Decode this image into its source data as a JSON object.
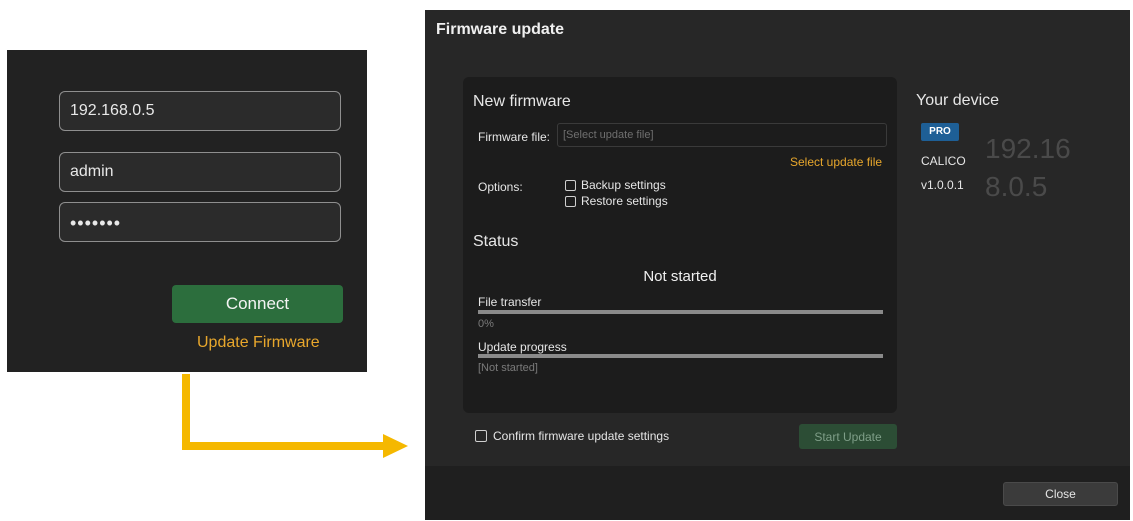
{
  "login": {
    "ip_value": "192.168.0.5",
    "username_value": "admin",
    "password_mask": "•••••••",
    "connect_label": "Connect",
    "update_firmware_label": "Update Firmware"
  },
  "dialog": {
    "title": "Firmware update",
    "new_firmware": {
      "title": "New firmware",
      "file_label": "Firmware file:",
      "file_placeholder": "[Select update file]",
      "select_link": "Select update file",
      "options_label": "Options:",
      "backup_label": "Backup settings",
      "restore_label": "Restore settings"
    },
    "status": {
      "title": "Status",
      "state": "Not started",
      "file_transfer_label": "File transfer",
      "file_transfer_value": "0%",
      "file_transfer_progress": 0,
      "update_progress_label": "Update progress",
      "update_progress_value": "[Not started]",
      "update_progress": 0
    },
    "device": {
      "title": "Your device",
      "badge": "PRO",
      "name": "CALICO",
      "version": "v1.0.0.1",
      "ip": "192.168.0.5"
    },
    "confirm_label": "Confirm firmware update settings",
    "start_label": "Start Update",
    "close_label": "Close"
  },
  "colors": {
    "accent_orange": "#e8a72c",
    "connect_green": "#2c6e3d",
    "arrow_yellow": "#f5b800",
    "pro_blue": "#1e5f96"
  }
}
